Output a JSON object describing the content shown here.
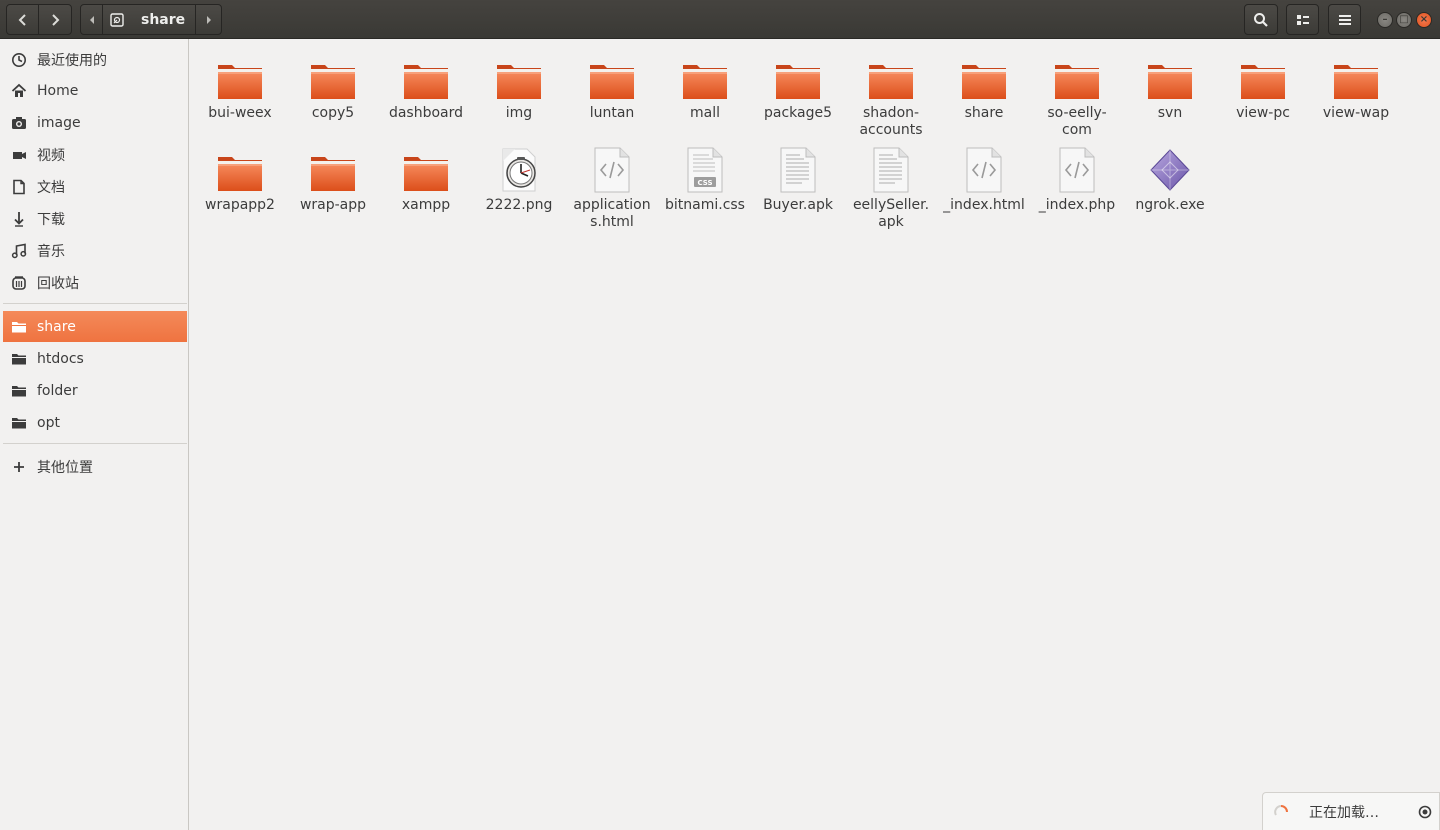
{
  "header": {
    "path_label": "share"
  },
  "sidebar": {
    "places": [
      {
        "label": "最近使用的",
        "icon": "clock-icon"
      },
      {
        "label": "Home",
        "icon": "home-icon"
      },
      {
        "label": "image",
        "icon": "camera-icon"
      },
      {
        "label": "视频",
        "icon": "video-icon"
      },
      {
        "label": "文档",
        "icon": "document-icon"
      },
      {
        "label": "下载",
        "icon": "download-icon"
      },
      {
        "label": "音乐",
        "icon": "music-icon"
      },
      {
        "label": "回收站",
        "icon": "trash-icon"
      }
    ],
    "bookmarks": [
      {
        "label": "share",
        "icon": "folder-icon",
        "active": true
      },
      {
        "label": "htdocs",
        "icon": "folder-icon"
      },
      {
        "label": "folder",
        "icon": "folder-icon"
      },
      {
        "label": "opt",
        "icon": "folder-icon"
      }
    ],
    "other": {
      "label": "其他位置",
      "icon": "plus-icon"
    }
  },
  "files": [
    {
      "name": "bui-weex",
      "type": "folder"
    },
    {
      "name": "copy5",
      "type": "folder"
    },
    {
      "name": "dashboard",
      "type": "folder"
    },
    {
      "name": "img",
      "type": "folder"
    },
    {
      "name": "luntan",
      "type": "folder"
    },
    {
      "name": "mall",
      "type": "folder"
    },
    {
      "name": "package5",
      "type": "folder"
    },
    {
      "name": "shadon-accounts",
      "type": "folder"
    },
    {
      "name": "share",
      "type": "folder"
    },
    {
      "name": "so-eelly-com",
      "type": "folder"
    },
    {
      "name": "svn",
      "type": "folder"
    },
    {
      "name": "view-pc",
      "type": "folder"
    },
    {
      "name": "view-wap",
      "type": "folder"
    },
    {
      "name": "wrapapp2",
      "type": "folder"
    },
    {
      "name": "wrap-app",
      "type": "folder"
    },
    {
      "name": "xampp",
      "type": "folder"
    },
    {
      "name": "2222.png",
      "type": "image"
    },
    {
      "name": "applications.html",
      "type": "html"
    },
    {
      "name": "bitnami.css",
      "type": "css"
    },
    {
      "name": "Buyer.apk",
      "type": "text"
    },
    {
      "name": "eellySeller.apk",
      "type": "text"
    },
    {
      "name": "_index.html",
      "type": "html"
    },
    {
      "name": "_index.php",
      "type": "html"
    },
    {
      "name": "ngrok.exe",
      "type": "exe"
    }
  ],
  "toast": {
    "text": "正在加载…"
  },
  "colors": {
    "accent": "#ef7340",
    "folder": "#e85a1e"
  }
}
